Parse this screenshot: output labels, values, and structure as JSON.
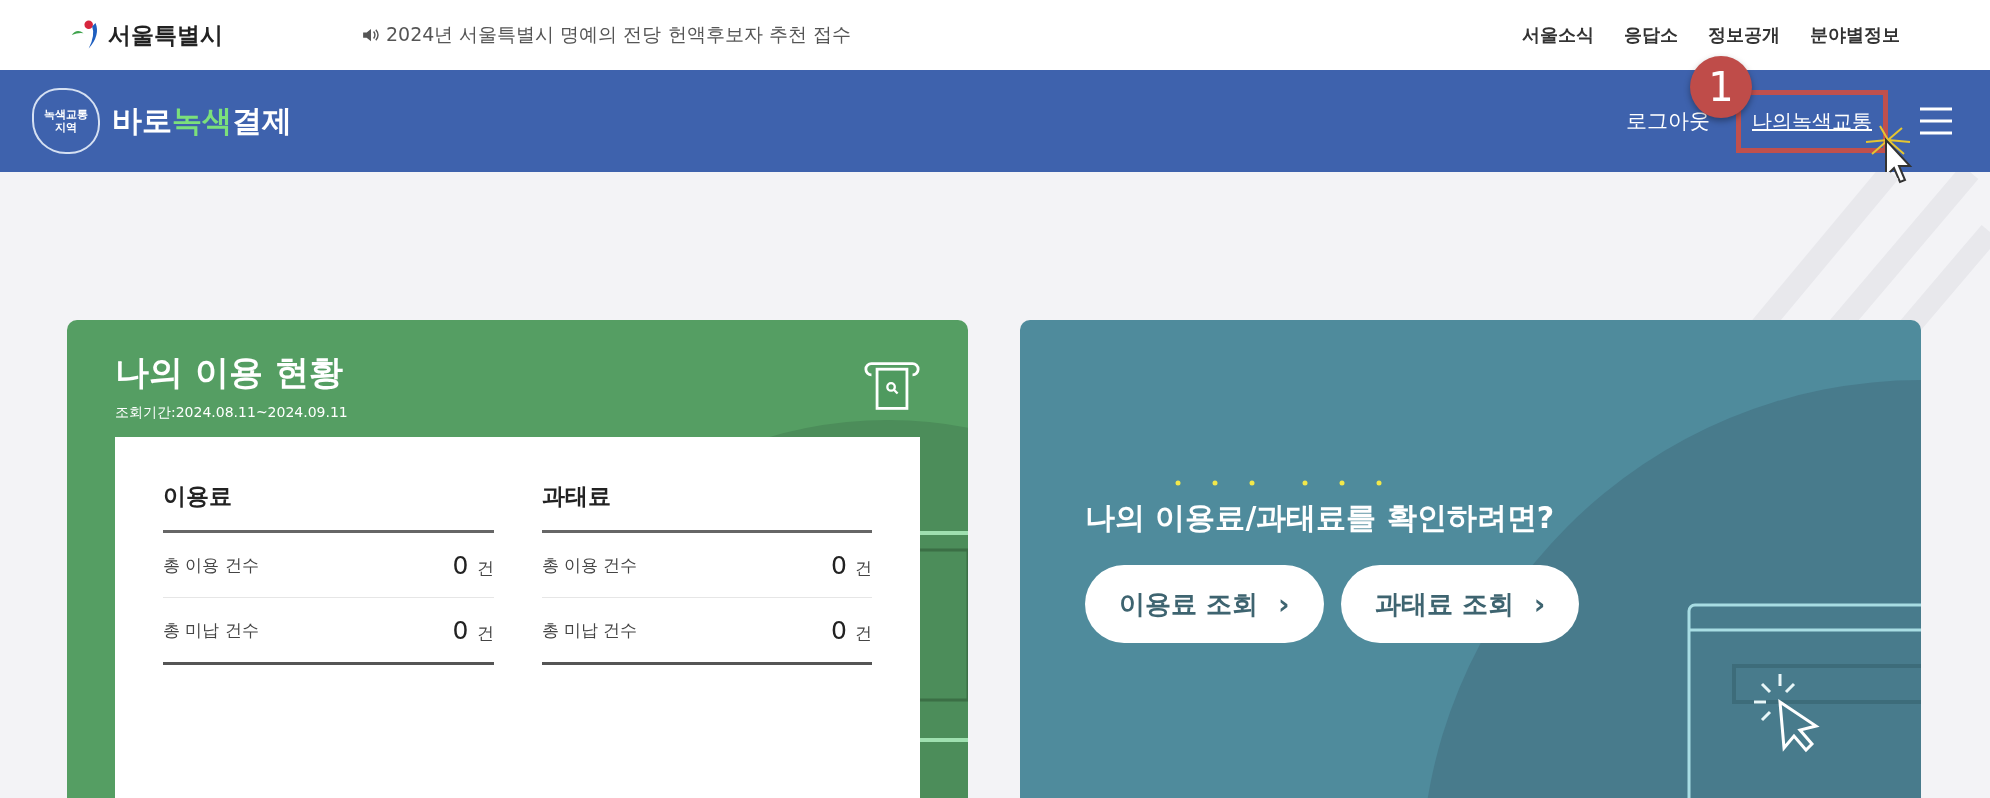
{
  "top_bar": {
    "org_name": "서울특별시",
    "notice": "2024년 서울특별시 명예의 전당 헌액후보자 추천 접수",
    "links": [
      "서울소식",
      "응답소",
      "정보공개",
      "분야별정보"
    ]
  },
  "header": {
    "emblem_text": "녹색교통\n지역",
    "brand": [
      {
        "text": "바로",
        "kind": "plain"
      },
      {
        "text": "녹색",
        "kind": "accent"
      },
      {
        "text": "결제",
        "kind": "plain"
      }
    ],
    "logout": "로그아웃",
    "my_link": "나의녹색교통",
    "step_badge": "1"
  },
  "usage_card": {
    "title": "나의 이용 현황",
    "period": "조회기간:2024.08.11~2024.09.11",
    "groups": [
      {
        "heading": "이용료",
        "rows": [
          {
            "label": "총 이용 건수",
            "value": "0",
            "unit": "건"
          },
          {
            "label": "총 미납 건수",
            "value": "0",
            "unit": "건"
          }
        ]
      },
      {
        "heading": "과태료",
        "rows": [
          {
            "label": "총 이용 건수",
            "value": "0",
            "unit": "건"
          },
          {
            "label": "총 미납 건수",
            "value": "0",
            "unit": "건"
          }
        ]
      }
    ]
  },
  "lookup_card": {
    "question": "나의 이용료/과태료를 확인하려면?",
    "buttons": [
      {
        "label": "이용료 조회",
        "icon": "›"
      },
      {
        "label": "과태료 조회",
        "icon": "›"
      }
    ]
  }
}
